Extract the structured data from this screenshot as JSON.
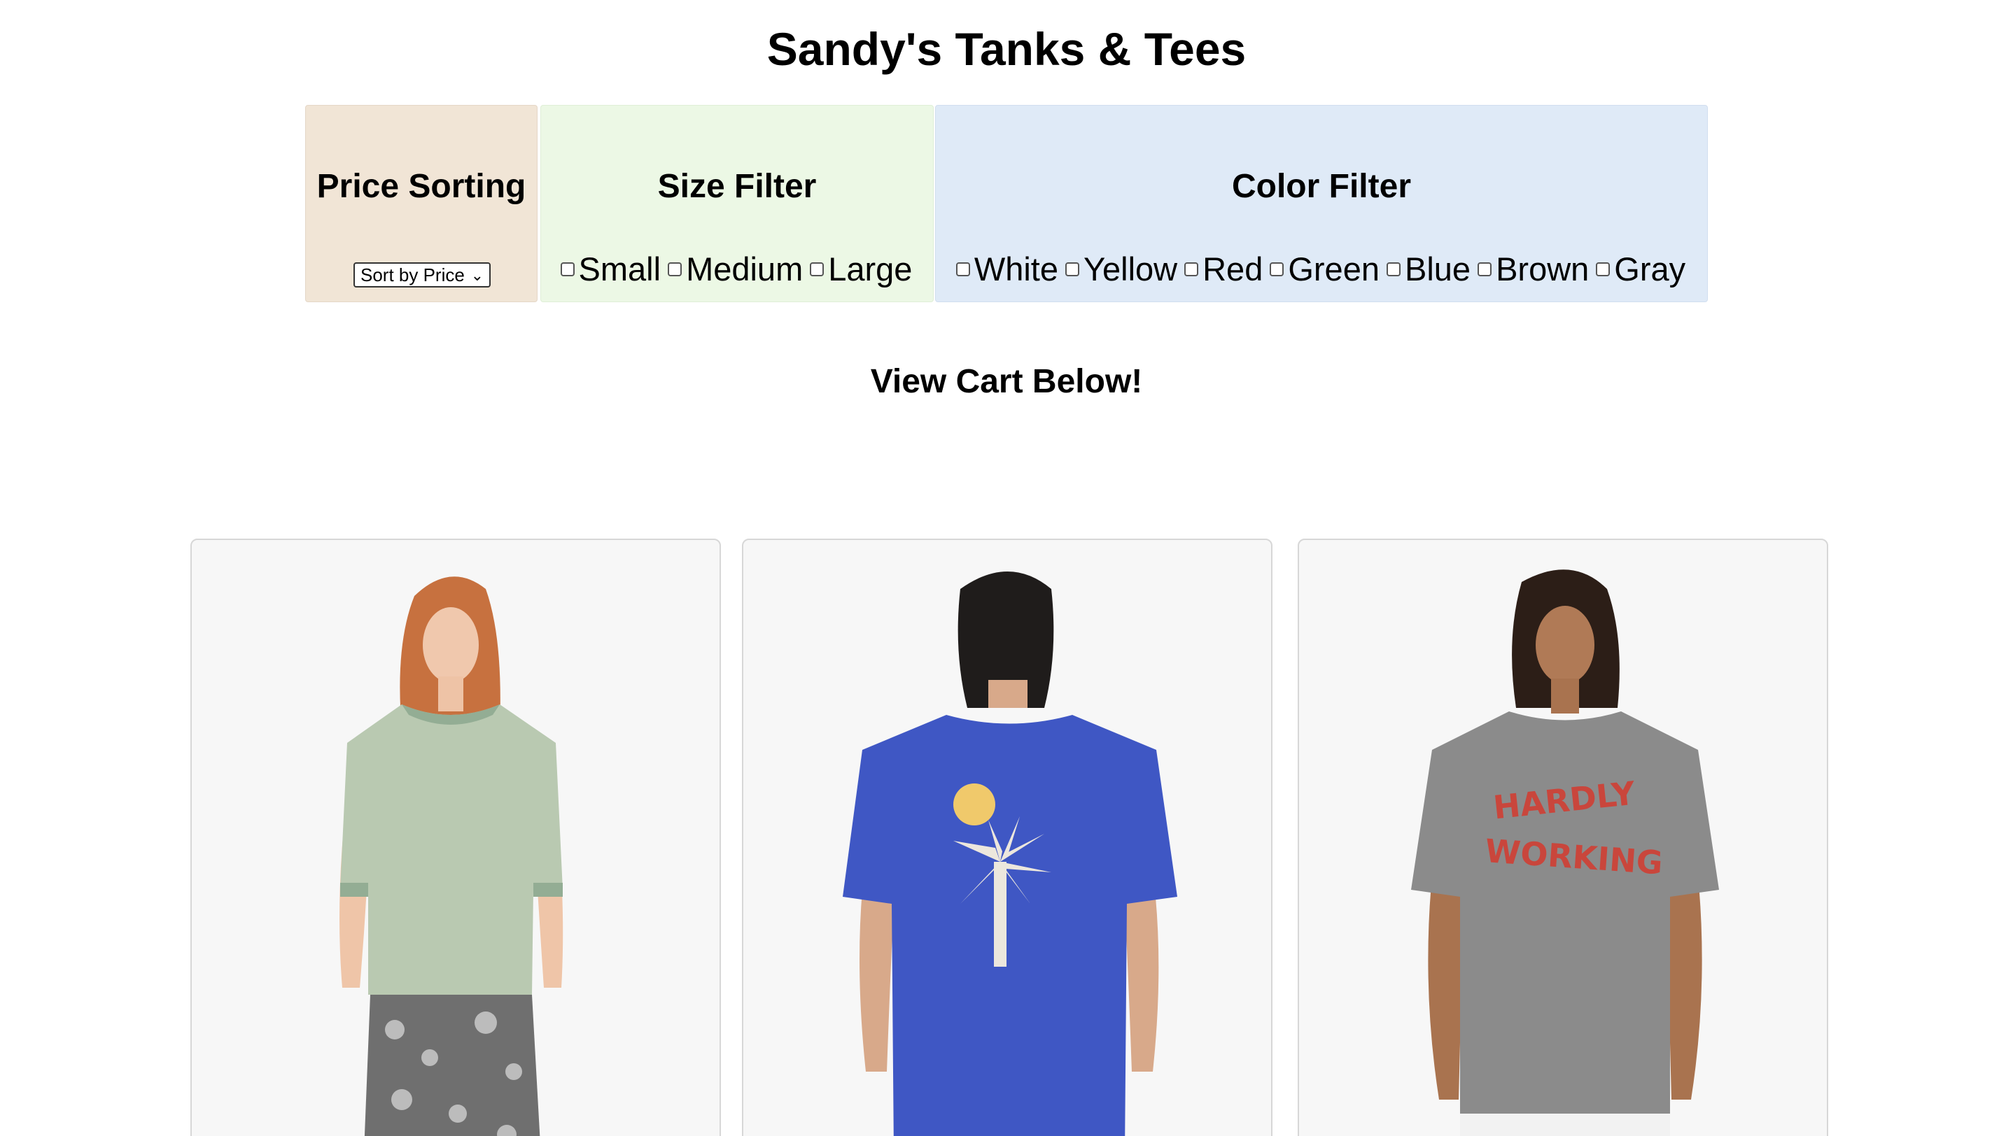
{
  "title": "Sandy's Tanks & Tees",
  "price_panel": {
    "heading": "Price Sorting",
    "select_value": "Sort by Price"
  },
  "size_panel": {
    "heading": "Size Filter",
    "options": [
      "Small",
      "Medium",
      "Large"
    ]
  },
  "color_panel": {
    "heading": "Color Filter",
    "options": [
      "White",
      "Yellow",
      "Red",
      "Green",
      "Blue",
      "Brown",
      "Gray"
    ]
  },
  "cart_heading": "View Cart Below!",
  "products": [
    {
      "image": "model-sage-green-ringer-tee",
      "shirt_color": "#b9c9b1"
    },
    {
      "image": "model-blue-palm-print-tee-back",
      "shirt_color": "#3f57c4"
    },
    {
      "image": "model-gray-hardly-working-tee",
      "shirt_color": "#8b8b8b",
      "shirt_print": [
        "HARDLY",
        "WORKING"
      ]
    }
  ],
  "colors": {
    "price_panel_bg": "#f1e5d6",
    "size_panel_bg": "#ecf8e5",
    "color_panel_bg": "#dfeaf7",
    "card_bg": "#f7f7f7"
  }
}
